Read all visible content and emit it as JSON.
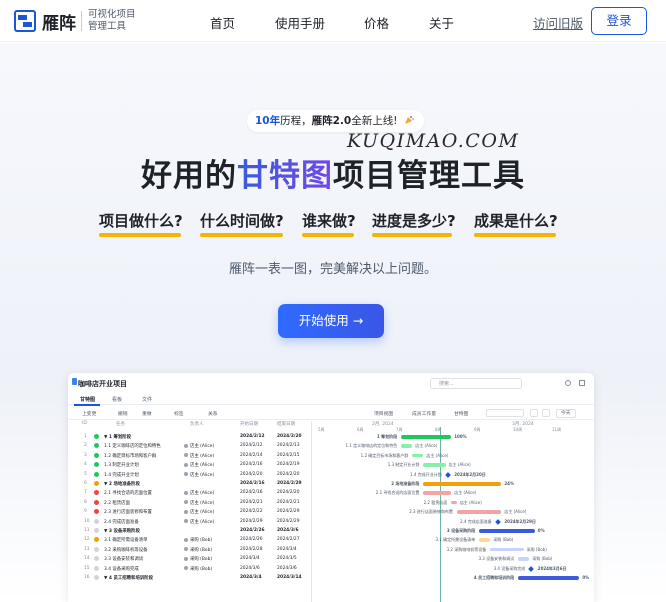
{
  "brand": {
    "name": "雁阵",
    "tagline_line1": "可视化项目",
    "tagline_line2": "管理工具",
    "accent": "#1a56db"
  },
  "nav": {
    "links": [
      "首页",
      "使用手册",
      "价格",
      "关于"
    ],
    "old_version": "访问旧版",
    "login": "登录"
  },
  "hero": {
    "pill_years": "10年",
    "pill_text1": "历程，",
    "pill_product": "雁阵2.0",
    "pill_text2": "全新上线!",
    "pill_icon": "party-popper-icon",
    "watermark": "KUQIMAO.COM",
    "title_prefix": "好用的",
    "title_highlight": "甘特图",
    "title_suffix": "项目管理工具",
    "questions": [
      "项目做什么?",
      "什么时间做?",
      "谁来做?",
      "进度是多少?",
      "成果是什么?"
    ],
    "subtitle": "雁阵一表一图，完美解决以上问题。",
    "cta": "开始使用 →"
  },
  "app": {
    "title": "咖啡店开业项目",
    "search_placeholder": "搜索...",
    "tabs": [
      "甘特图",
      "看板",
      "文件"
    ],
    "toolbar": [
      "上变更",
      "撤销",
      "重做",
      "标签",
      "关系",
      "视图",
      "项目视图",
      "成员工作量",
      "甘特图",
      "今天"
    ],
    "columns": [
      "ID",
      "任务",
      "负责人",
      "开始日期",
      "结束日期"
    ],
    "rows": [
      {
        "n": "1",
        "task": "▼ 1 筹划阶段",
        "owner": "",
        "start": "2024/2/12",
        "end": "2024/2/20",
        "bold": true,
        "status": "done"
      },
      {
        "n": "2",
        "task": "1.1 定义咖啡店的定位和特色",
        "owner": "店主 (Alice)",
        "start": "2024/2/12",
        "end": "2024/2/13",
        "bold": false,
        "status": "done"
      },
      {
        "n": "3",
        "task": "1.2 确定目标市场和客户群",
        "owner": "店主 (Alice)",
        "start": "2024/2/14",
        "end": "2024/2/15",
        "bold": false,
        "status": "done"
      },
      {
        "n": "4",
        "task": "1.3 制定开业计划",
        "owner": "店主 (Alice)",
        "start": "2024/2/16",
        "end": "2024/2/19",
        "bold": false,
        "status": "done"
      },
      {
        "n": "5",
        "task": "1.4 完成开业计划",
        "owner": "店主 (Alice)",
        "start": "2024/2/20",
        "end": "2024/2/20",
        "bold": false,
        "status": "done"
      },
      {
        "n": "6",
        "task": "▼ 2 场地准备阶段",
        "owner": "",
        "start": "2024/2/16",
        "end": "2024/2/29",
        "bold": true,
        "status": "warn"
      },
      {
        "n": "7",
        "task": "2.1 寻找合适的店面位置",
        "owner": "店主 (Alice)",
        "start": "2024/2/16",
        "end": "2024/2/20",
        "bold": false,
        "status": "late"
      },
      {
        "n": "8",
        "task": "2.2 租赁店面",
        "owner": "店主 (Alice)",
        "start": "2024/2/21",
        "end": "2024/2/21",
        "bold": false,
        "status": "late"
      },
      {
        "n": "9",
        "task": "2.3 进行店面装修和布置",
        "owner": "店主 (Alice)",
        "start": "2024/2/22",
        "end": "2024/2/29",
        "bold": false,
        "status": "late"
      },
      {
        "n": "10",
        "task": "2.4 完成店面准备",
        "owner": "店主 (Alice)",
        "start": "2024/2/29",
        "end": "2024/2/29",
        "bold": false,
        "status": "none"
      },
      {
        "n": "11",
        "task": "▼ 3 设备采购阶段",
        "owner": "",
        "start": "2024/2/26",
        "end": "2024/3/6",
        "bold": true,
        "status": "none"
      },
      {
        "n": "12",
        "task": "3.1 确定所需设备清单",
        "owner": "采购 (Bob)",
        "start": "2024/2/26",
        "end": "2024/2/27",
        "bold": false,
        "status": "warn"
      },
      {
        "n": "13",
        "task": "3.2 采购咖啡机等设备",
        "owner": "采购 (Bob)",
        "start": "2024/2/28",
        "end": "2024/3/4",
        "bold": false,
        "status": "none"
      },
      {
        "n": "14",
        "task": "3.3 设备安装和调试",
        "owner": "采购 (Bob)",
        "start": "2024/3/4",
        "end": "2024/3/5",
        "bold": false,
        "status": "none"
      },
      {
        "n": "15",
        "task": "3.4 设备采购完成",
        "owner": "采购 (Bob)",
        "start": "2024/3/6",
        "end": "2024/3/6",
        "bold": false,
        "status": "none"
      },
      {
        "n": "16",
        "task": "▼ 4 员工招聘和培训阶段",
        "owner": "",
        "start": "2024/3/4",
        "end": "2024/3/14",
        "bold": true,
        "status": "none"
      }
    ],
    "gantt": {
      "months": [
        "2月, 2024",
        "3月, 2024"
      ],
      "weeks": [
        "5周",
        "6周",
        "7周",
        "8周",
        "9周",
        "10周",
        "11周"
      ],
      "labels": [
        {
          "text": "1 筹划阶段",
          "pct": "100%"
        },
        {
          "text": "1.1 定义咖啡店的定位和特色",
          "owner": "店主 (Alice)"
        },
        {
          "text": "1.2 确定目标市场和客户群",
          "owner": "店主 (Alice)"
        },
        {
          "text": "1.3 制定开业计划",
          "owner": "店主 (Alice)"
        },
        {
          "text": "1.4 完成开业计划",
          "date": "2024年2月20日"
        },
        {
          "text": "2 场地准备阶段",
          "pct": "24%"
        },
        {
          "text": "2.1 寻找合适的店面位置",
          "owner": "店主 (Alice)"
        },
        {
          "text": "2.2 租赁店面",
          "owner": "店主 (Alice)"
        },
        {
          "text": "2.3 进行店面装修和布置",
          "owner": "店主 (Alice)"
        },
        {
          "text": "2.4 完成店面准备",
          "date": "2024年2月29日"
        },
        {
          "text": "3 设备采购阶段",
          "pct": "0%"
        },
        {
          "text": "3.1 确定所需设备清单",
          "owner": "采购 (Bob)"
        },
        {
          "text": "3.2 采购咖啡机等设备",
          "owner": "采购 (Bob)"
        },
        {
          "text": "3.3 设备安装和调试",
          "owner": "采购 (Bob)"
        },
        {
          "text": "3.4 设备采购完成",
          "date": "2024年3月6日"
        },
        {
          "text": "4 员工招聘和培训阶段",
          "pct": "0%"
        }
      ]
    }
  }
}
